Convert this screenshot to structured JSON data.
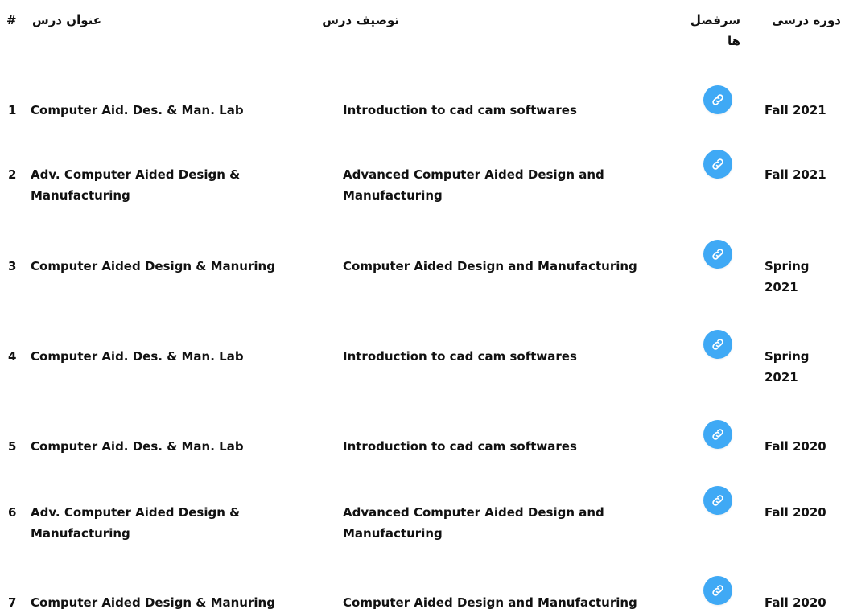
{
  "header": {
    "num": "#",
    "title": "عنوان درس",
    "description": "توصیف درس",
    "syllabus": "سرفصل ها",
    "term": "دوره درسی"
  },
  "rows": [
    {
      "num": "1",
      "title": "Computer Aid. Des. & Man. Lab",
      "description": "Introduction to cad cam softwares",
      "term": "Fall 2021",
      "link_icon": "link-icon"
    },
    {
      "num": "2",
      "title": "Adv. Computer Aided Design & Manufacturing",
      "description": "Advanced Computer Aided Design and Manufacturing",
      "term": "Fall 2021",
      "link_icon": "link-icon"
    },
    {
      "num": "3",
      "title": "Computer Aided Design & Manuring",
      "description": "Computer Aided Design and Manufacturing",
      "term": "Spring 2021",
      "link_icon": "link-icon"
    },
    {
      "num": "4",
      "title": "Computer Aid. Des. & Man. Lab",
      "description": "Introduction to cad cam softwares",
      "term": "Spring 2021",
      "link_icon": "link-icon"
    },
    {
      "num": "5",
      "title": "Computer Aid. Des. & Man. Lab",
      "description": "Introduction to cad cam softwares",
      "term": "Fall 2020",
      "link_icon": "link-icon"
    },
    {
      "num": "6",
      "title": "Adv. Computer Aided Design & Manufacturing",
      "description": "Advanced Computer Aided Design and Manufacturing",
      "term": "Fall 2020",
      "link_icon": "link-icon"
    },
    {
      "num": "7",
      "title": "Computer Aided Design & Manuring",
      "description": "Computer Aided Design and Manufacturing",
      "term": "Fall 2020",
      "link_icon": "link-icon"
    }
  ],
  "colors": {
    "link_button": "#3fa9f5",
    "text": "#111111",
    "background": "#ffffff"
  }
}
